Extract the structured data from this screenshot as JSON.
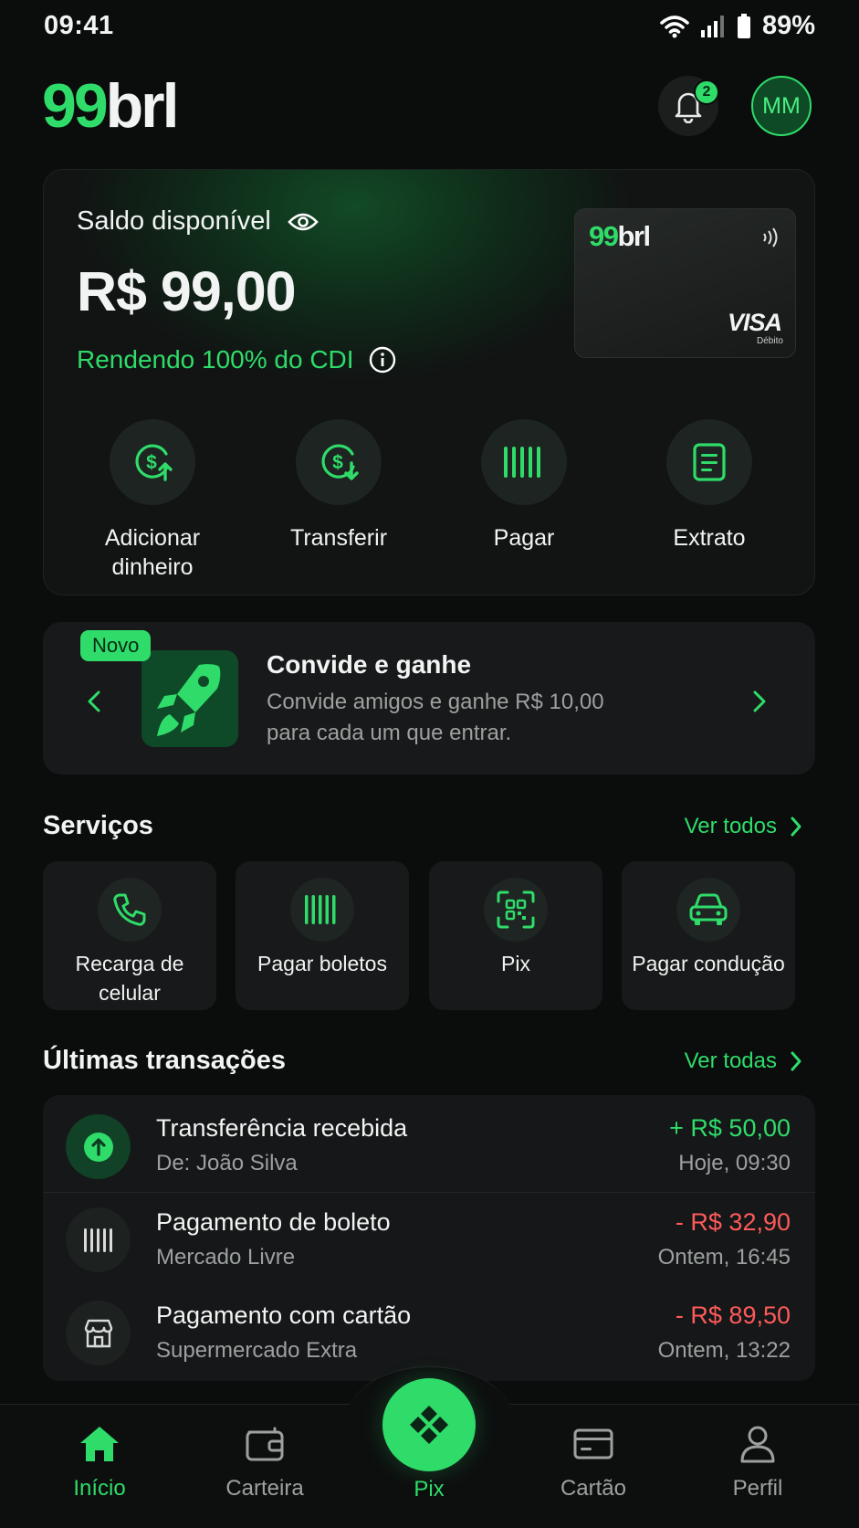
{
  "status_bar": {
    "time": "09:41",
    "battery": "89%"
  },
  "header": {
    "logo_part1": "99",
    "logo_part2": "brl",
    "notification_count": "2",
    "avatar_initials": "MM"
  },
  "balance": {
    "label": "Saldo disponível",
    "value": "R$ 99,00",
    "yield_text": "Rendendo 100% do CDI",
    "card": {
      "logo_part1": "99",
      "logo_part2": "brl",
      "brand": "VISA",
      "type": "Débito"
    }
  },
  "actions": [
    {
      "label": "Adicionar dinheiro",
      "icon": "dollar-add-icon"
    },
    {
      "label": "Transferir",
      "icon": "dollar-transfer-icon"
    },
    {
      "label": "Pagar",
      "icon": "barcode-icon"
    },
    {
      "label": "Extrato",
      "icon": "document-icon"
    }
  ],
  "promo": {
    "badge": "Novo",
    "title": "Convide e ganhe",
    "text": "Convide amigos e ganhe R$ 10,00 para cada um que entrar.",
    "icon": "rocket-icon"
  },
  "services": {
    "title": "Serviços",
    "see_all": "Ver todos",
    "items": [
      {
        "label": "Recarga de celular",
        "icon": "phone-icon"
      },
      {
        "label": "Pagar boletos",
        "icon": "barcode-icon"
      },
      {
        "label": "Pix",
        "icon": "qr-scan-icon"
      },
      {
        "label": "Pagar condução",
        "icon": "car-icon"
      }
    ]
  },
  "transactions": {
    "title": "Últimas transações",
    "see_all": "Ver todas",
    "items": [
      {
        "title": "Transferência recebida",
        "subtitle": "De: João Silva",
        "amount": "+ R$ 50,00",
        "time": "Hoje, 09:30",
        "icon": "arrow-up-icon",
        "amount_color": "#2fdc6a"
      },
      {
        "title": "Pagamento de boleto",
        "subtitle": "Mercado Livre",
        "amount": "- R$ 32,90",
        "time": "Ontem, 16:45",
        "icon": "barcode-icon",
        "amount_color": "#ff5a5a"
      },
      {
        "title": "Pagamento com cartão",
        "subtitle": "Supermercado Extra",
        "amount": "- R$ 89,50",
        "time": "Ontem, 13:22",
        "icon": "store-icon",
        "amount_color": "#ff5a5a"
      }
    ]
  },
  "bottom_nav": [
    {
      "label": "Início",
      "icon": "home-icon",
      "active": true
    },
    {
      "label": "Carteira",
      "icon": "wallet-icon",
      "active": false
    },
    {
      "label": "Pix",
      "icon": "pix-icon",
      "active": true
    },
    {
      "label": "Cartão",
      "icon": "card-icon",
      "active": false
    },
    {
      "label": "Perfil",
      "icon": "user-icon",
      "active": false
    }
  ],
  "colors": {
    "accent": "#2fdc6a",
    "negative": "#ff5a5a",
    "background": "#0b0c0c"
  }
}
